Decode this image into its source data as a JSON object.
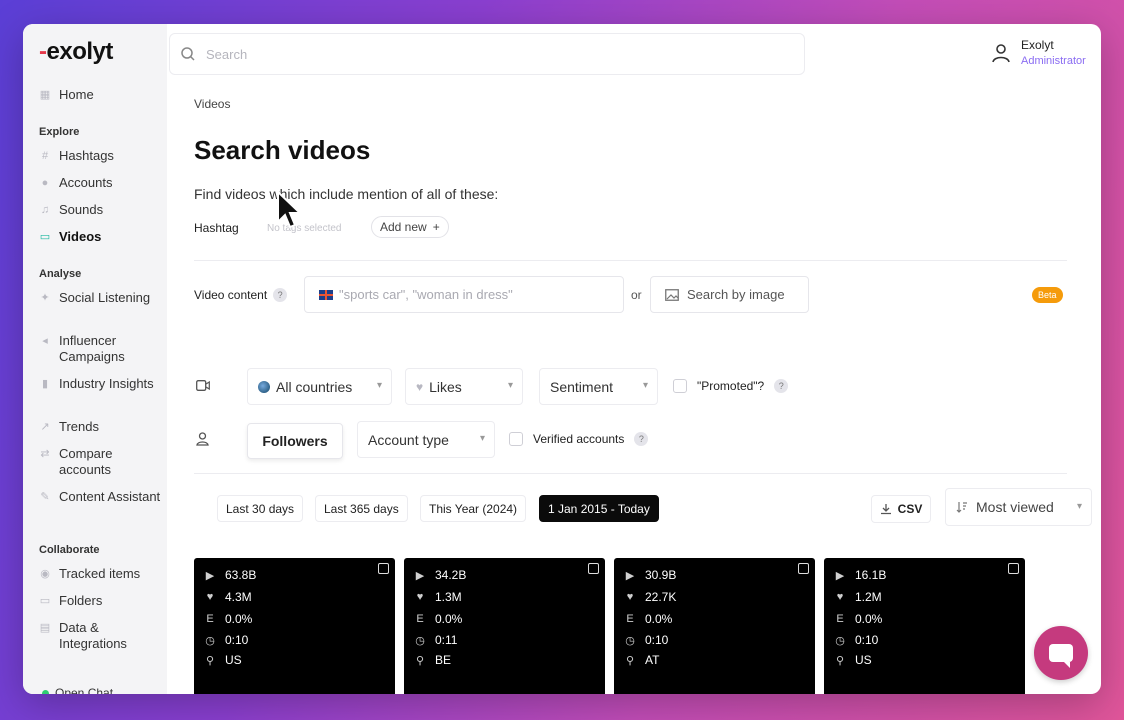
{
  "brand": {
    "logo_text": "exolyt"
  },
  "search": {
    "placeholder": "Search"
  },
  "user": {
    "name": "Exolyt",
    "role": "Administrator"
  },
  "sidebar": {
    "home": "Home",
    "explore_label": "Explore",
    "explore": [
      "Hashtags",
      "Accounts",
      "Sounds",
      "Videos"
    ],
    "analyse_label": "Analyse",
    "analyse": [
      "Social Listening",
      "Influencer Campaigns",
      "Industry Insights",
      "Trends",
      "Compare accounts",
      "Content Assistant"
    ],
    "collaborate_label": "Collaborate",
    "collaborate": [
      "Tracked items",
      "Folders",
      "Data & Integrations"
    ],
    "open_chat": "Open Chat"
  },
  "page": {
    "breadcrumb": "Videos",
    "title": "Search videos",
    "subtitle": "Find videos which include mention of all of these:",
    "hashtag_label": "Hashtag",
    "no_tags": "No tags selected",
    "add_new": "Add new",
    "video_content_label": "Video content",
    "video_content_placeholder": "\"sports car\", \"woman in dress\"",
    "or": "or",
    "search_by_image": "Search by image",
    "beta": "Beta"
  },
  "filters": {
    "countries": "All countries",
    "likes": "Likes",
    "sentiment": "Sentiment",
    "promoted": "\"Promoted\"?",
    "followers": "Followers",
    "account_type": "Account type",
    "verified": "Verified accounts"
  },
  "date_ranges": [
    "Last 30 days",
    "Last 365 days",
    "This Year (2024)",
    "1 Jan 2015 - Today"
  ],
  "actions": {
    "csv": "CSV",
    "sort": "Most viewed"
  },
  "videos": [
    {
      "views": "63.8B",
      "likes": "4.3M",
      "engagement": "0.0%",
      "duration": "0:10",
      "country": "US"
    },
    {
      "views": "34.2B",
      "likes": "1.3M",
      "engagement": "0.0%",
      "duration": "0:11",
      "country": "BE"
    },
    {
      "views": "30.9B",
      "likes": "22.7K",
      "engagement": "0.0%",
      "duration": "0:10",
      "country": "AT"
    },
    {
      "views": "16.1B",
      "likes": "1.2M",
      "engagement": "0.0%",
      "duration": "0:10",
      "country": "US"
    }
  ],
  "colors": {
    "accent": "#8a6cf2",
    "active_nav": "#1fb8a0",
    "beta": "#f59b0b",
    "chat": "#c53a7e"
  }
}
